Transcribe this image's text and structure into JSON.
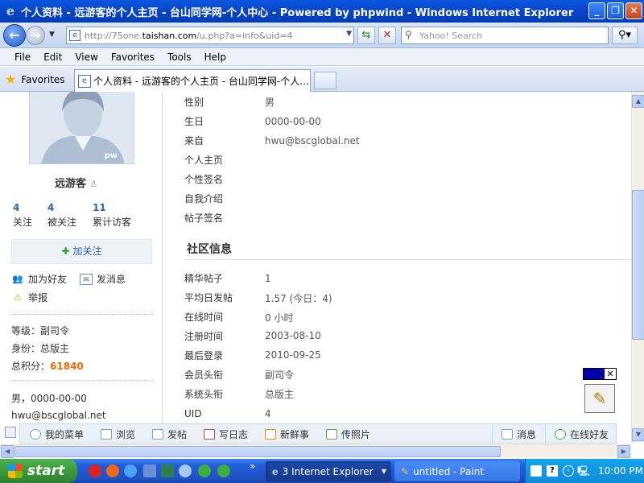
{
  "window": {
    "title": "个人资料 - 远游客的个人主页 - 台山同学网-个人中心 - Powered by phpwind - Windows Internet Explorer",
    "icon": "ie-icon"
  },
  "address": {
    "url_prefix": "http://75one.",
    "url_domain": "taishan.com",
    "url_suffix": "/u.php?a=info&uid=4"
  },
  "search": {
    "placeholder": "Yahoo! Search"
  },
  "menu": [
    "File",
    "Edit",
    "View",
    "Favorites",
    "Tools",
    "Help"
  ],
  "favorites_label": "Favorites",
  "tab": {
    "title": "个人资料 - 远游客的个人主页 - 台山同学网-个人..."
  },
  "profile": {
    "avatar_watermark": "pw",
    "username": "远游客",
    "stats": [
      {
        "num": "4",
        "label": "关注"
      },
      {
        "num": "4",
        "label": "被关注"
      },
      {
        "num": "11",
        "label": "累计访客"
      }
    ],
    "follow_button": "加关注",
    "add_friend": "加为好友",
    "send_message": "发消息",
    "report": "举报",
    "level_label": "等级：",
    "level": "副司令",
    "identity_label": "身份：",
    "identity": "总版主",
    "points_label": "总积分：",
    "points": "61840",
    "gender_birth": "男，0000-00-00",
    "email": "hwu@bscglobal.net"
  },
  "info": {
    "basic": [
      {
        "label": "性别",
        "value": "男"
      },
      {
        "label": "生日",
        "value": "0000-00-00"
      },
      {
        "label": "来自",
        "value": "hwu@bscglobal.net"
      },
      {
        "label": "个人主页",
        "value": ""
      },
      {
        "label": "个性签名",
        "value": ""
      },
      {
        "label": "自我介绍",
        "value": ""
      },
      {
        "label": "帖子签名",
        "value": ""
      }
    ],
    "community_title": "社区信息",
    "community": [
      {
        "label": "精华帖子",
        "value": "1"
      },
      {
        "label": "平均日发帖",
        "value": "1.57 (今日：4)"
      },
      {
        "label": "在线时间",
        "value": "0 小时"
      },
      {
        "label": "注册时间",
        "value": "2003-08-10"
      },
      {
        "label": "最后登录",
        "value": "2010-09-25"
      },
      {
        "label": "会员头衔",
        "value": "副司令"
      },
      {
        "label": "系统头衔",
        "value": "总版主"
      },
      {
        "label": "UID",
        "value": "4"
      }
    ]
  },
  "pagebar": {
    "my_menu": "我的菜单",
    "browse": "浏览",
    "post": "发帖",
    "blog": "写日志",
    "news": "新鲜事",
    "photos": "传照片",
    "messages": "消息",
    "online_friends": "在线好友"
  },
  "taskbar": {
    "start": "start",
    "items": [
      "3 Internet Explorer",
      "untitled - Paint"
    ],
    "clock": "10:00 PM"
  },
  "colors": {
    "accent_blue": "#2a66b0",
    "points_orange": "#f06a00",
    "xp_titlebar": "#0a46c8",
    "taskbar": "#245edb"
  }
}
